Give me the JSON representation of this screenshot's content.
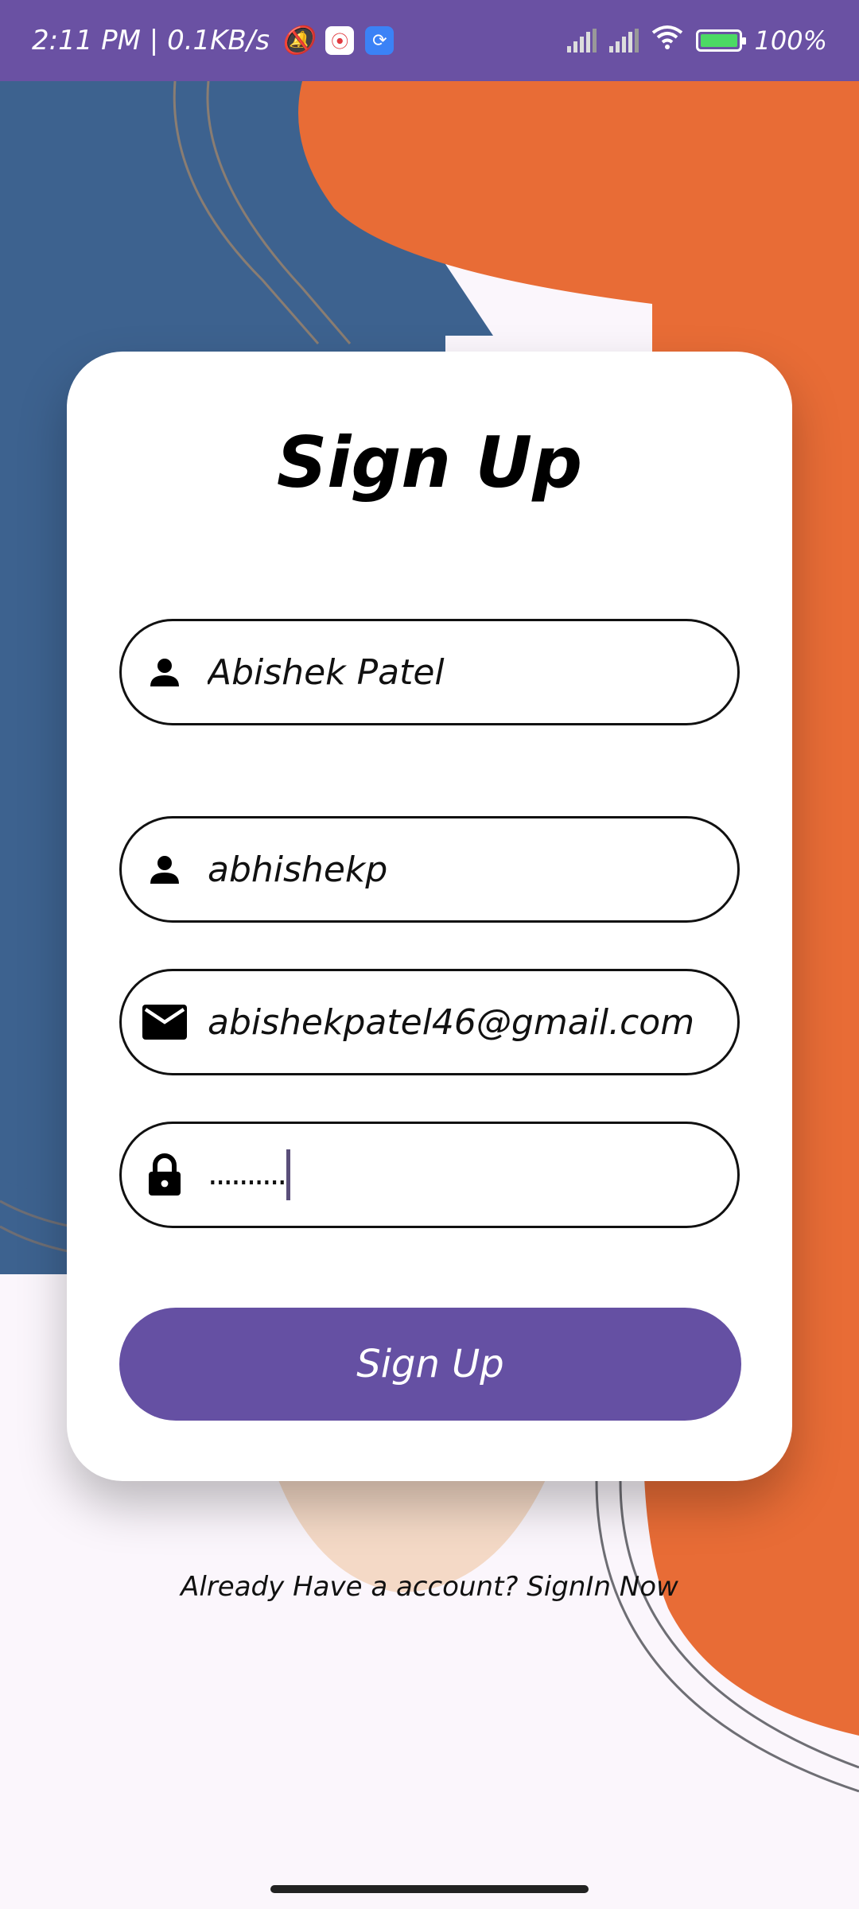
{
  "status_bar": {
    "time_speed": "2:11 PM | 0.1KB/s",
    "battery_percent": "100%"
  },
  "form": {
    "title": "Sign Up",
    "full_name": "Abishek Patel",
    "username": "abhishekp",
    "email": "abishekpatel46@gmail.com",
    "password_masked": "..........",
    "submit_label": "Sign Up"
  },
  "footer": {
    "signin_text": "Already Have a account? SignIn Now"
  },
  "colors": {
    "accent": "#6550a3",
    "orange": "#e86c36",
    "blue": "#3d628f",
    "peach": "#f4d9c6"
  }
}
